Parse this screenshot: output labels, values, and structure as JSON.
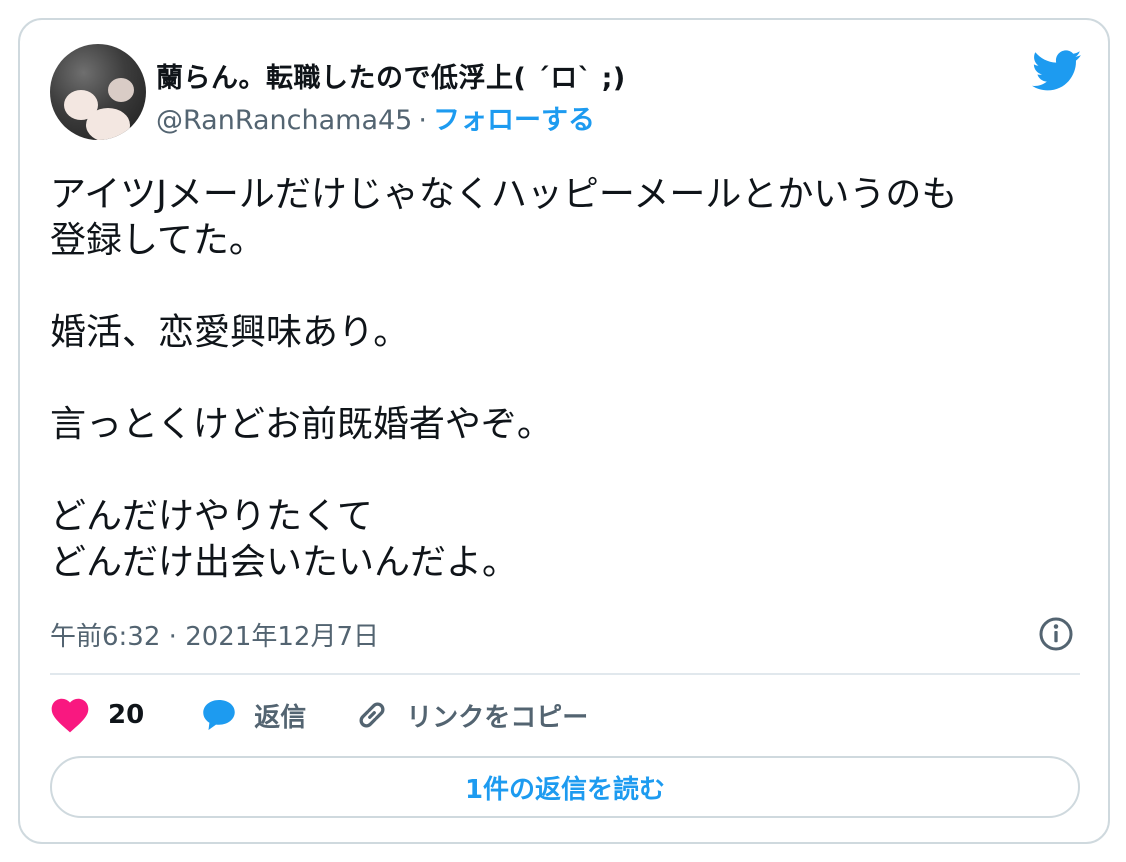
{
  "author": {
    "name": "蘭らん。転職したので低浮上( ´ロ` ;)",
    "handle": "@RanRanchama45",
    "separator": "·",
    "follow_label": "フォローする",
    "avatar_icon": "avatar-cat-paw"
  },
  "brand": {
    "icon": "twitter-bird-icon",
    "color": "#1d9bf0"
  },
  "tweet": {
    "text": "アイツJメールだけじゃなくハッピーメールとかいうのも\n登録してた。\n\n婚活、恋愛興味あり。\n\n言っとくけどお前既婚者やぞ。\n\nどんだけやりたくて\nどんだけ出会いたいんだよ。"
  },
  "meta": {
    "time": "午前6:32",
    "separator": "·",
    "date": "2021年12月7日",
    "info_icon": "info-icon"
  },
  "actions": {
    "like_icon": "heart-icon",
    "like_count": "20",
    "like_color": "#f91880",
    "reply_icon": "speech-bubble-icon",
    "reply_label": "返信",
    "copy_icon": "link-icon",
    "copy_label": "リンクをコピー"
  },
  "footer": {
    "read_replies_label": "1件の返信を読む"
  }
}
